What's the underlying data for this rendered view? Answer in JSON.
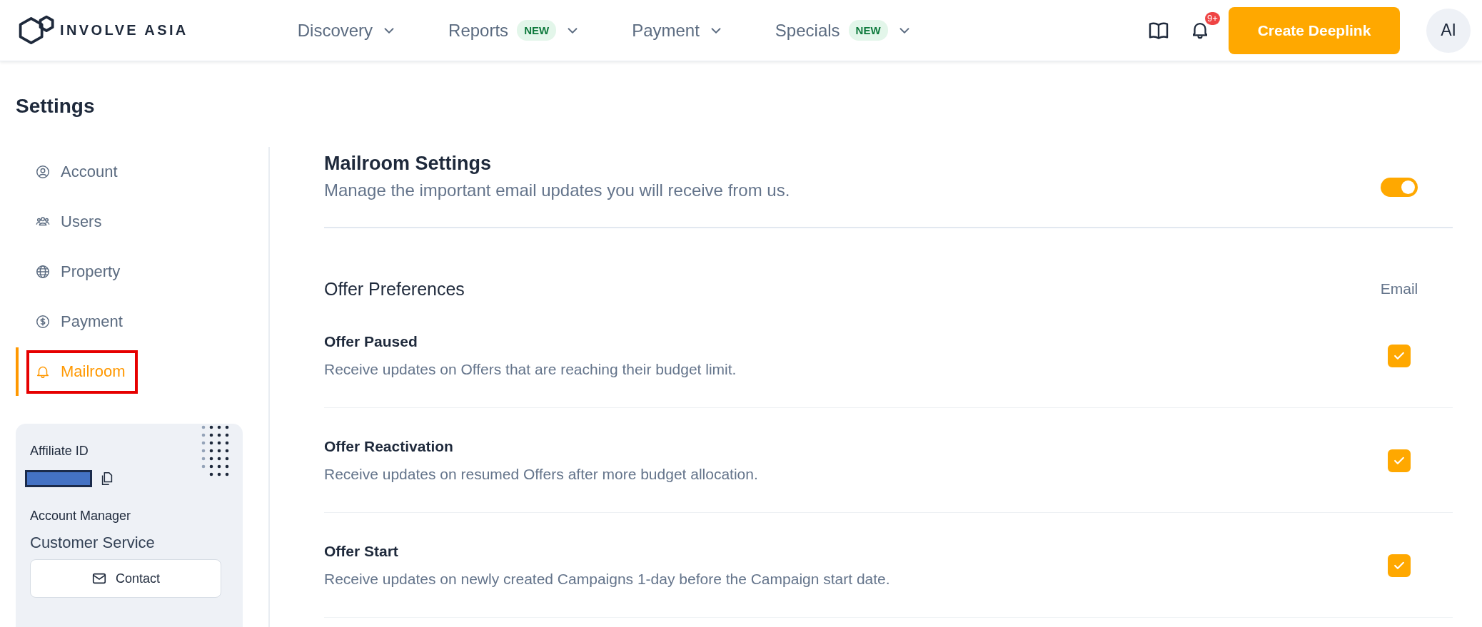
{
  "header": {
    "logo_text": "INVOLVE ASIA",
    "nav": [
      {
        "label": "Discovery"
      },
      {
        "label": "Reports",
        "badge": "NEW"
      },
      {
        "label": "Payment"
      },
      {
        "label": "Specials",
        "badge": "NEW"
      }
    ],
    "notification_count": "9+",
    "cta": "Create Deeplink",
    "avatar": "AI"
  },
  "page_title": "Settings",
  "sidebar": {
    "items": [
      {
        "label": "Account",
        "kind": "account",
        "selected": false,
        "highlighted": false
      },
      {
        "label": "Users",
        "kind": "users",
        "selected": false,
        "highlighted": false
      },
      {
        "label": "Property",
        "kind": "property",
        "selected": false,
        "highlighted": false
      },
      {
        "label": "Payment",
        "kind": "payment",
        "selected": false,
        "highlighted": false
      },
      {
        "label": "Mailroom",
        "kind": "mailroom",
        "selected": true,
        "highlighted": true
      }
    ]
  },
  "affiliate_card": {
    "id_label": "Affiliate ID",
    "manager_label": "Account Manager",
    "manager_name": "Customer Service",
    "contact_button": "Contact"
  },
  "mailroom": {
    "title": "Mailroom Settings",
    "subtitle": "Manage the important email updates you will receive from us.",
    "enabled": true,
    "section_title": "Offer Preferences",
    "column_label": "Email",
    "preferences": [
      {
        "title": "Offer Paused",
        "description": "Receive updates on Offers that are reaching their budget limit.",
        "email": true
      },
      {
        "title": "Offer Reactivation",
        "description": "Receive updates on resumed Offers after more budget allocation.",
        "email": true
      },
      {
        "title": "Offer Start",
        "description": "Receive updates on newly created Campaigns 1-day before the Campaign start date.",
        "email": true
      }
    ]
  }
}
